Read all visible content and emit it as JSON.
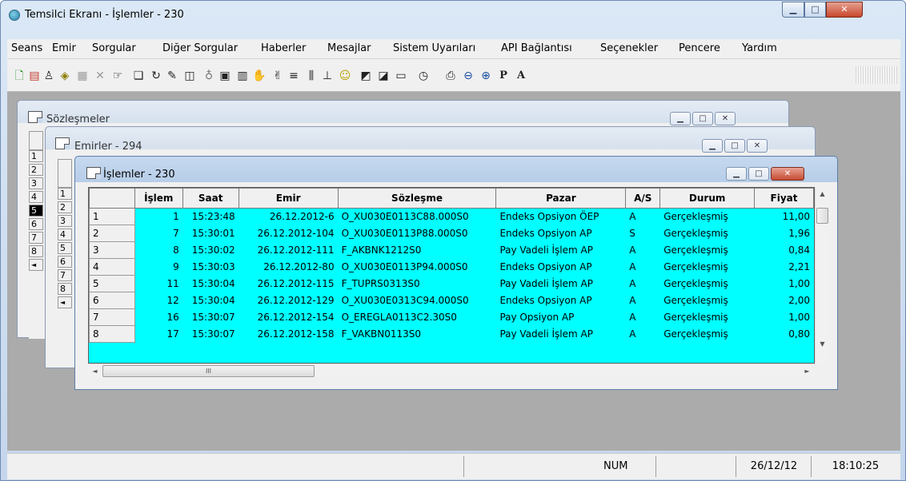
{
  "window": {
    "title": "Temsilci Ekranı - İşlemler - 230",
    "min": "▁",
    "max": "□",
    "close": "✕"
  },
  "menu": [
    "Seans",
    "Emir",
    "Sorgular",
    "Diğer Sorgular",
    "Haberler",
    "Mesajlar",
    "Sistem Uyarıları",
    "API Bağlantısı",
    "Seçenekler",
    "Pencere",
    "Yardım"
  ],
  "toolbar_icons": [
    {
      "name": "new-doc-icon",
      "glyph": "🗋",
      "color": "#1c8c1c"
    },
    {
      "name": "doc-red-icon",
      "glyph": "▤",
      "color": "#c0392b"
    },
    {
      "name": "person-icon",
      "glyph": "♙",
      "color": "#222"
    },
    {
      "name": "eraser-icon",
      "glyph": "◈",
      "color": "#8a7a00"
    },
    {
      "name": "properties-icon",
      "glyph": "▦",
      "color": "#999"
    },
    {
      "name": "delete-icon",
      "glyph": "✕",
      "color": "#999"
    },
    {
      "name": "hand-pointer-icon",
      "glyph": "☞",
      "color": "#222"
    },
    {
      "name": "window-icon",
      "glyph": "❏",
      "color": "#222"
    },
    {
      "name": "rotate-icon",
      "glyph": "↻",
      "color": "#222"
    },
    {
      "name": "pencil-icon",
      "glyph": "✎",
      "color": "#222"
    },
    {
      "name": "book-icon",
      "glyph": "◫",
      "color": "#222"
    },
    {
      "name": "bottle-icon",
      "glyph": "♁",
      "color": "#777"
    },
    {
      "name": "chart-icon",
      "glyph": "▣",
      "color": "#222"
    },
    {
      "name": "report-icon",
      "glyph": "▥",
      "color": "#222"
    },
    {
      "name": "handshake-icon",
      "glyph": "✋",
      "color": "#222"
    },
    {
      "name": "hand-icon",
      "glyph": "✌",
      "color": "#222"
    },
    {
      "name": "lines-icon",
      "glyph": "≡",
      "color": "#222"
    },
    {
      "name": "columns-icon",
      "glyph": "⫼",
      "color": "#222"
    },
    {
      "name": "bar-icon",
      "glyph": "⊥",
      "color": "#222"
    },
    {
      "name": "smiley-icon",
      "glyph": "☺",
      "color": "#b8a000"
    },
    {
      "name": "analysis-icon",
      "glyph": "◩",
      "color": "#222"
    },
    {
      "name": "analysis2-icon",
      "glyph": "◪",
      "color": "#222"
    },
    {
      "name": "folder-icon",
      "glyph": "▭",
      "color": "#222"
    },
    {
      "name": "clock-icon",
      "glyph": "◷",
      "color": "#222"
    },
    {
      "name": "print-icon",
      "glyph": "⎙",
      "color": "#222"
    },
    {
      "name": "zoom-out-icon",
      "glyph": "⊖",
      "color": "#1a4fa0"
    },
    {
      "name": "zoom-in-icon",
      "glyph": "⊕",
      "color": "#1a4fa0"
    },
    {
      "name": "p-icon",
      "glyph": "P",
      "color": "#222"
    },
    {
      "name": "a-icon",
      "glyph": "A",
      "color": "#222"
    }
  ],
  "windows": {
    "sozlesmeler": {
      "title": "Sözleşmeler",
      "rows": [
        "1",
        "2",
        "3",
        "4",
        "5",
        "6",
        "7",
        "8"
      ],
      "selected_row": "5"
    },
    "emirler": {
      "title": "Emirler - 294",
      "rows": [
        "1",
        "2",
        "3",
        "4",
        "5",
        "6",
        "7",
        "8"
      ]
    },
    "islemler": {
      "title": "İşlemler - 230"
    }
  },
  "grid": {
    "columns": [
      "",
      "İşlem",
      "Saat",
      "Emir",
      "Sözleşme",
      "Pazar",
      "A/S",
      "Durum",
      "Fiyat"
    ],
    "rows": [
      [
        "1",
        "1",
        "15:23:48",
        "26.12.2012-6",
        "O_XU030E0113C88.000S0",
        "Endeks Opsiyon ÖEP",
        "A",
        "Gerçekleşmiş",
        "11,00"
      ],
      [
        "2",
        "7",
        "15:30:01",
        "26.12.2012-104",
        "O_XU030E0113P88.000S0",
        "Endeks Opsiyon AP",
        "S",
        "Gerçekleşmiş",
        "1,96"
      ],
      [
        "3",
        "8",
        "15:30:02",
        "26.12.2012-111",
        "F_AKBNK1212S0",
        "Pay Vadeli İşlem AP",
        "A",
        "Gerçekleşmiş",
        "0,84"
      ],
      [
        "4",
        "9",
        "15:30:03",
        "26.12.2012-80",
        "O_XU030E0113P94.000S0",
        "Endeks Opsiyon AP",
        "A",
        "Gerçekleşmiş",
        "2,21"
      ],
      [
        "5",
        "11",
        "15:30:04",
        "26.12.2012-115",
        "F_TUPRS0313S0",
        "Pay Vadeli İşlem AP",
        "A",
        "Gerçekleşmiş",
        "1,00"
      ],
      [
        "6",
        "12",
        "15:30:04",
        "26.12.2012-129",
        "O_XU030E0313C94.000S0",
        "Endeks Opsiyon AP",
        "A",
        "Gerçekleşmiş",
        "2,00"
      ],
      [
        "7",
        "16",
        "15:30:07",
        "26.12.2012-154",
        "O_EREGLA0113C2.30S0",
        "Pay Opsiyon AP",
        "A",
        "Gerçekleşmiş",
        "1,00"
      ],
      [
        "8",
        "17",
        "15:30:07",
        "26.12.2012-158",
        "F_VAKBN0113S0",
        "Pay Vadeli İşlem AP",
        "A",
        "Gerçekleşmiş",
        "0,80"
      ]
    ]
  },
  "scroll": {
    "thumb_h": "III",
    "left_arrow": "◄",
    "right_arrow": "►",
    "up_arrow": "▲",
    "down_arrow": "▼"
  },
  "status": {
    "num": "NUM",
    "date": "26/12/12",
    "time": "18:10:25"
  }
}
